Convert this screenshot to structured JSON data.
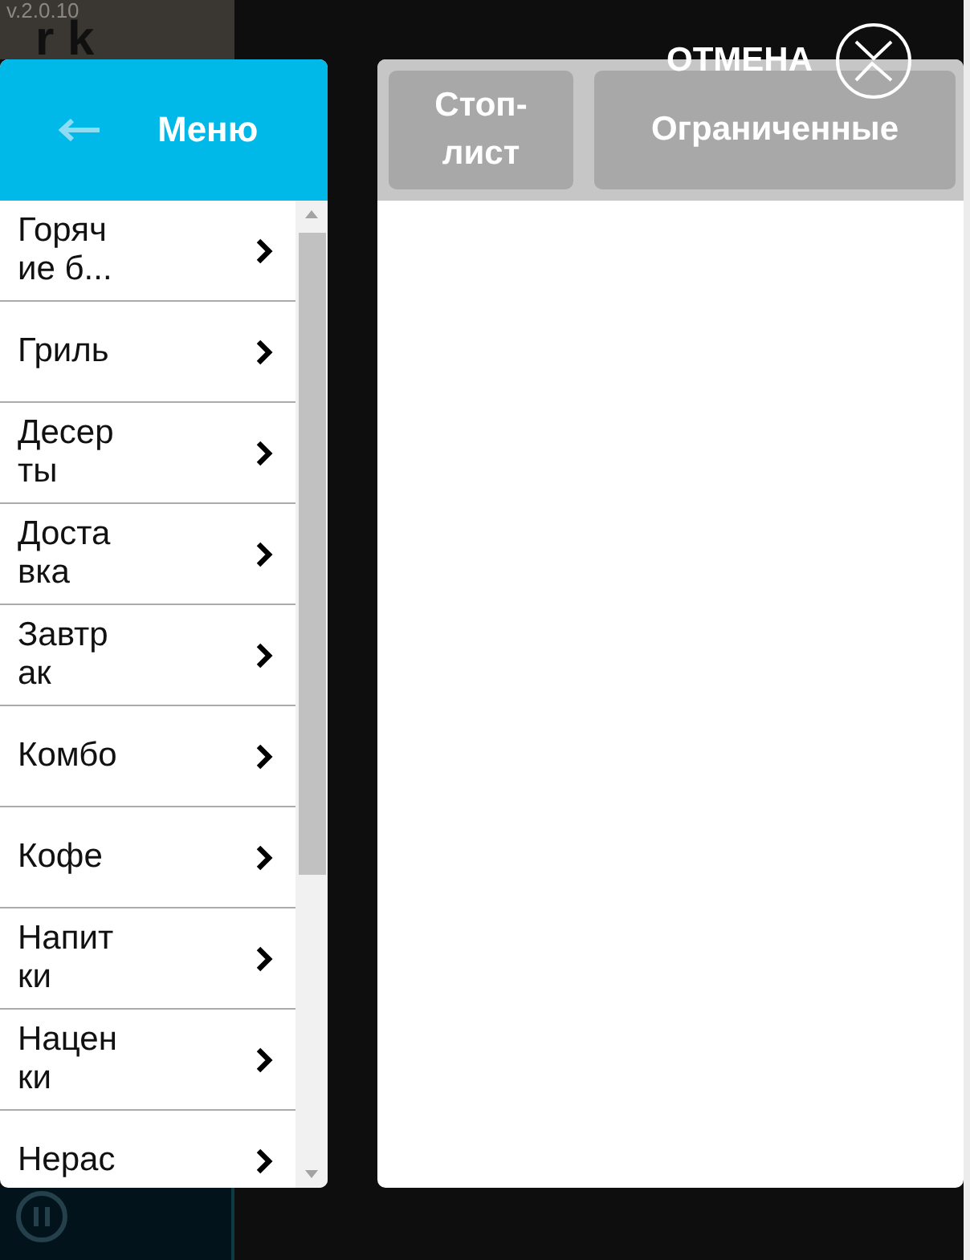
{
  "background": {
    "version": "v.2.0.10",
    "logo": "r k"
  },
  "menu": {
    "title": "Меню",
    "items": [
      {
        "label": "Горячие б..."
      },
      {
        "label": "Гриль"
      },
      {
        "label": "Десерты"
      },
      {
        "label": "Доставка"
      },
      {
        "label": "Завтрак"
      },
      {
        "label": "Комбо"
      },
      {
        "label": "Кофе"
      },
      {
        "label": "Напитки"
      },
      {
        "label": "Наценки"
      },
      {
        "label": "Нерас"
      }
    ]
  },
  "filters": [
    {
      "label": "Стоп-лист"
    },
    {
      "label": "Ограниченные"
    }
  ],
  "cancel": {
    "label": "ОТМЕНА"
  }
}
